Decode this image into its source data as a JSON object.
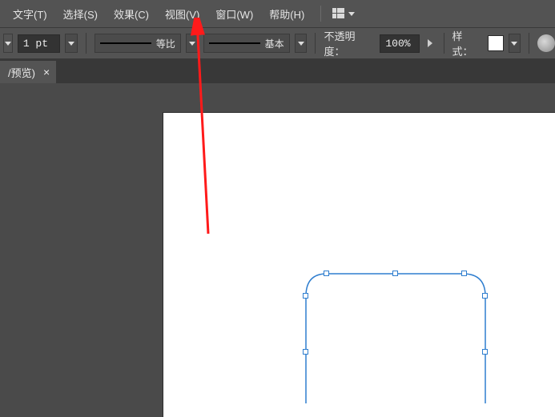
{
  "menu": {
    "text": "文字(T)",
    "select": "选择(S)",
    "effect": "效果(C)",
    "view": "视图(V)",
    "window": "窗口(W)",
    "help": "帮助(H)"
  },
  "options": {
    "stroke_weight": "1 pt",
    "profile_label1": "等比",
    "profile_label2": "基本",
    "opacity_label": "不透明度：",
    "opacity_value": "100%",
    "style_label": "样式："
  },
  "tab": {
    "title": "/预览)",
    "close": "×"
  }
}
